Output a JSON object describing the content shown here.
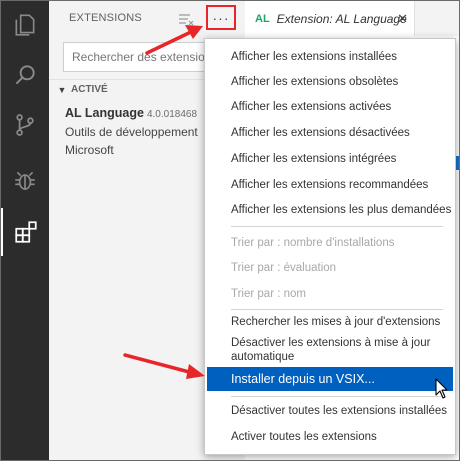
{
  "sidebar": {
    "title": "EXTENSIONS",
    "more_actions_label": "···",
    "search_placeholder": "Rechercher des extensions",
    "section_label": "ACTIVÉ",
    "extension": {
      "name": "AL Language",
      "version": "4.0.018468",
      "description": "Outils de développement",
      "publisher": "Microsoft"
    }
  },
  "editor": {
    "tab_icon": "AL",
    "tab_label": "Extension: AL Language",
    "tab_close": "✕"
  },
  "context_menu": {
    "items": [
      {
        "label": "Afficher les extensions installées"
      },
      {
        "label": "Afficher les extensions obsolètes"
      },
      {
        "label": "Afficher les extensions activées"
      },
      {
        "label": "Afficher les extensions désactivées"
      },
      {
        "label": "Afficher les extensions intégrées"
      },
      {
        "label": "Afficher les extensions recommandées"
      },
      {
        "label": "Afficher les extensions les plus demandées"
      },
      {
        "label": "Trier par : nombre d'installations"
      },
      {
        "label": "Trier par : évaluation"
      },
      {
        "label": "Trier par : nom"
      },
      {
        "label": "Rechercher les mises à jour d'extensions"
      },
      {
        "label": "Désactiver les extensions à mise à jour automatique"
      },
      {
        "label": "Installer depuis un VSIX..."
      },
      {
        "label": "Désactiver toutes les extensions installées"
      },
      {
        "label": "Activer toutes les extensions"
      }
    ]
  },
  "icons": {
    "activity_bar": [
      "explorer-icon",
      "search-icon",
      "source-control-icon",
      "debug-icon",
      "extensions-icon"
    ],
    "clear_filter": "clear-filter-icon",
    "annotation": "red-arrow"
  },
  "colors": {
    "accent_highlight": "#0060c0",
    "annotation_red": "#e8262a",
    "activity_bar_bg": "#2c2c2c"
  }
}
